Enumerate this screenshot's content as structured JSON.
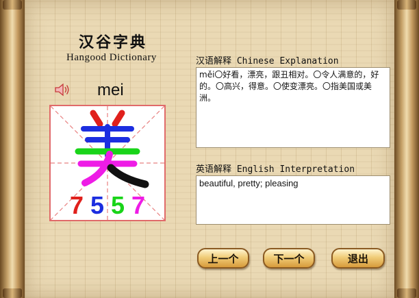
{
  "app": {
    "title_cn": "汉谷字典",
    "title_en": "Hangood Dictionary"
  },
  "entry": {
    "pinyin": "mei",
    "character": "美",
    "stroke_digits": [
      {
        "digit": "7",
        "color": "#e0201c"
      },
      {
        "digit": "5",
        "color": "#1c2ee0"
      },
      {
        "digit": "5",
        "color": "#19d419"
      },
      {
        "digit": "7",
        "color": "#ee1ce6"
      }
    ],
    "stroke_colors": {
      "top_dots": "#e0201c",
      "horizontals": "#1c2ee0",
      "middle": "#19d419",
      "bottom": "#ee1ce6",
      "final": "#111111"
    }
  },
  "chinese_explanation": {
    "label_cn": "汉语解释",
    "label_en": "Chinese Explanation",
    "text": "měi〇好看，漂亮，跟丑相对。〇令人满意的，好的。〇高兴，得意。〇使变漂亮。〇指美国或美洲。"
  },
  "english_interpretation": {
    "label_cn": "英语解释",
    "label_en": "English Interpretation",
    "text": "beautiful, pretty; pleasing"
  },
  "buttons": {
    "prev": "上一个",
    "next": "下一个",
    "exit": "退出"
  },
  "icons": {
    "speaker": "speaker-icon"
  }
}
